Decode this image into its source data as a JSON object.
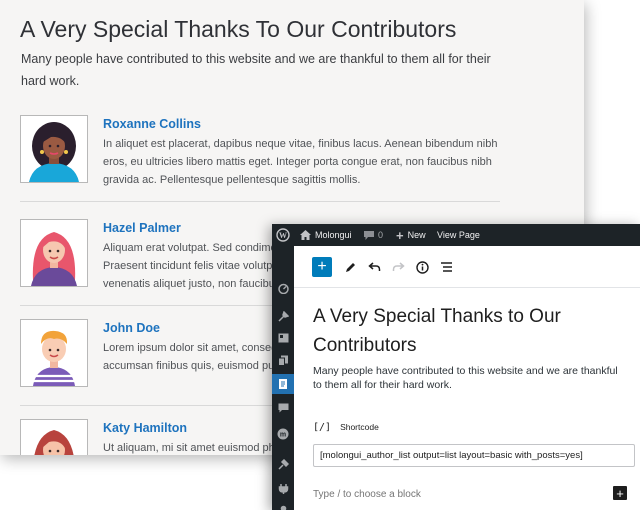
{
  "preview": {
    "title": "A Very Special Thanks To Our Contributors",
    "intro": "Many people have contributed to this website and we are thankful to them all for their hard work.",
    "authors": [
      {
        "name": "Roxanne Collins",
        "bio": "In aliquet est placerat, dapibus neque vitae, finibus lacus. Aenean bibendum nibh eros, eu ultricies libero mattis eget. Integer porta congue erat, non faucibus nibh gravida ac. Pellentesque pellentesque sagittis mollis."
      },
      {
        "name": "Hazel Palmer",
        "bio": "Aliquam erat volutpat. Sed condimentum nibh eros, eu ultricies libero mattis eget. Praesent tincidunt felis vitae volutpat, dapibus neque vitae, finibus tellus. Aenean venenatis aliquet justo, non faucibus."
      },
      {
        "name": "John Doe",
        "bio": "Lorem ipsum dolor sit amet, consectetur adipiscing elit, eu ultricies libero mattis accumsan finibus quis, euismod pulvinar."
      },
      {
        "name": "Katy Hamilton",
        "bio": "Ut aliquam, mi sit amet euismod pharetra, finibus lacus."
      }
    ]
  },
  "editor": {
    "adminbar": {
      "site_name": "Molongui",
      "comments_count": "0",
      "new_label": "New",
      "view_page_label": "View Page"
    },
    "title": "A Very Special Thanks to Our Contributors",
    "intro": "Many people have contributed to this website and we are thankful to them all for their hard work.",
    "shortcode_block_label": "Shortcode",
    "shortcode_icon_text": "[/]",
    "shortcode_value": "[molongui_author_list output=list layout=basic with_posts=yes]",
    "placeholder": "Type / to choose a block",
    "inserter_label": "+",
    "toolbar_add_label": "+"
  },
  "colors": {
    "link_blue": "#1e73be",
    "wp_blue": "#007cba",
    "admin_dark": "#1d2327"
  }
}
